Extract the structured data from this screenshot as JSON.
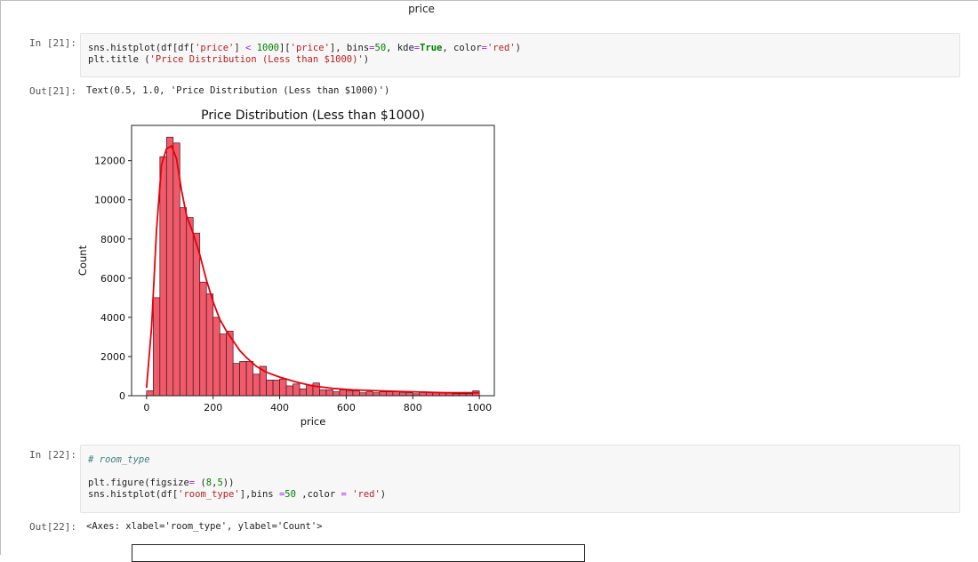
{
  "previous_output": {
    "xlabel": "price"
  },
  "cell21": {
    "in_prompt": "In [21]:",
    "code_lines": [
      [
        [
          "p",
          "sns.histplot(df[df["
        ],
        [
          "s",
          "'price'"
        ],
        [
          "p",
          "] "
        ],
        [
          "o",
          "<"
        ],
        [
          "p",
          " "
        ],
        [
          "n",
          "1000"
        ],
        [
          "p",
          "]["
        ],
        [
          "s",
          "'price'"
        ],
        [
          "p",
          "], bins"
        ],
        [
          "o",
          "="
        ],
        [
          "n",
          "50"
        ],
        [
          "p",
          ", kde"
        ],
        [
          "o",
          "="
        ],
        [
          "k",
          "True"
        ],
        [
          "p",
          ", color"
        ],
        [
          "o",
          "="
        ],
        [
          "s",
          "'red'"
        ],
        [
          "p",
          ")"
        ]
      ],
      [
        [
          "p",
          "plt.title ("
        ],
        [
          "s",
          "'Price Distribution (Less than $1000)'"
        ],
        [
          "p",
          ")"
        ]
      ]
    ],
    "out_prompt": "Out[21]:",
    "out_text": "Text(0.5, 1.0, 'Price Distribution (Less than $1000)')"
  },
  "chart_data": {
    "type": "bar",
    "title": "Price Distribution (Less than $1000)",
    "xlabel": "price",
    "ylabel": "Count",
    "xlim": [
      -45,
      1045
    ],
    "ylim": [
      0,
      13800
    ],
    "xticks": [
      0,
      200,
      400,
      600,
      800,
      1000
    ],
    "yticks": [
      0,
      2000,
      4000,
      6000,
      8000,
      10000,
      12000
    ],
    "bin_edges_start": 0,
    "bin_width": 20,
    "bins": [
      250,
      5000,
      12200,
      13200,
      12900,
      9600,
      9100,
      8300,
      5800,
      5200,
      4000,
      3150,
      3300,
      1650,
      1750,
      1750,
      1100,
      1500,
      800,
      800,
      850,
      500,
      600,
      350,
      550,
      650,
      300,
      300,
      200,
      300,
      250,
      250,
      150,
      200,
      150,
      200,
      200,
      200,
      150,
      150,
      100,
      200,
      150,
      150,
      150,
      150,
      100,
      100,
      100,
      250
    ],
    "kde": [
      [
        0,
        400
      ],
      [
        15,
        3500
      ],
      [
        30,
        8500
      ],
      [
        45,
        11800
      ],
      [
        60,
        12600
      ],
      [
        75,
        12750
      ],
      [
        90,
        12100
      ],
      [
        105,
        10500
      ],
      [
        120,
        9200
      ],
      [
        140,
        8300
      ],
      [
        160,
        7200
      ],
      [
        180,
        5900
      ],
      [
        200,
        4800
      ],
      [
        220,
        3900
      ],
      [
        240,
        3300
      ],
      [
        260,
        2800
      ],
      [
        280,
        2300
      ],
      [
        300,
        1950
      ],
      [
        330,
        1500
      ],
      [
        360,
        1200
      ],
      [
        400,
        950
      ],
      [
        450,
        700
      ],
      [
        500,
        500
      ],
      [
        560,
        370
      ],
      [
        620,
        300
      ],
      [
        700,
        250
      ],
      [
        800,
        200
      ],
      [
        900,
        150
      ],
      [
        1000,
        150
      ]
    ],
    "bar_color": "#f05a6b",
    "bar_edge": "#3a1a1e",
    "kde_color": "#e8000b",
    "grid": false
  },
  "cell22": {
    "in_prompt": "In [22]:",
    "code_lines": [
      [
        [
          "c",
          "# room_type"
        ]
      ],
      [
        [
          "p",
          ""
        ]
      ],
      [
        [
          "p",
          "plt.figure(figsize"
        ],
        [
          "o",
          "="
        ],
        [
          "p",
          " ("
        ],
        [
          "n",
          "8"
        ],
        [
          "p",
          ","
        ],
        [
          "n",
          "5"
        ],
        [
          "p",
          "))"
        ]
      ],
      [
        [
          "p",
          "sns.histplot(df["
        ],
        [
          "s",
          "'room_type'"
        ],
        [
          "p",
          "],bins "
        ],
        [
          "o",
          "="
        ],
        [
          "n",
          "50"
        ],
        [
          "p",
          " ,color "
        ],
        [
          "o",
          "="
        ],
        [
          "p",
          " "
        ],
        [
          "s",
          "'red'"
        ],
        [
          "p",
          ")"
        ]
      ]
    ],
    "out_prompt": "Out[22]:",
    "out_text": "<Axes: xlabel='room_type', ylabel='Count'>"
  }
}
